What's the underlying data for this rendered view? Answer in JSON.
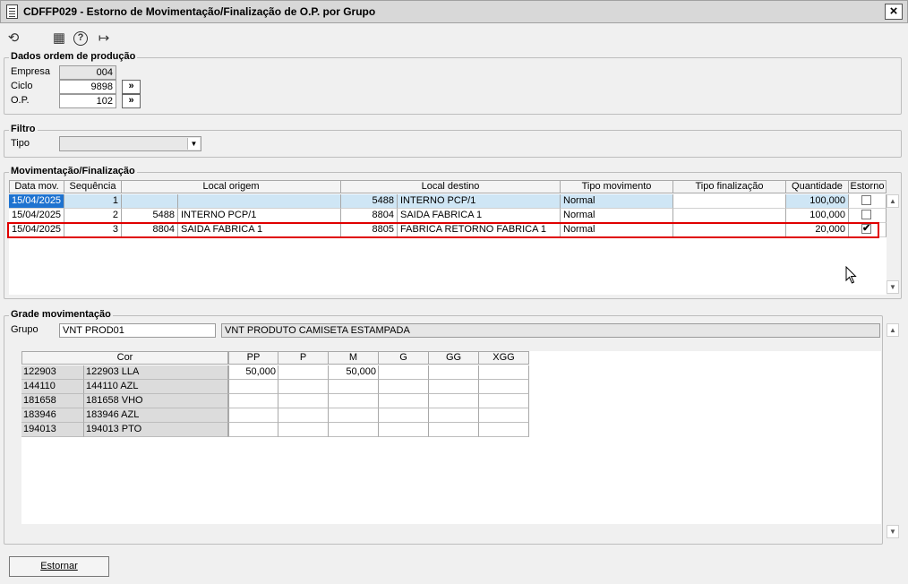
{
  "window": {
    "title": "CDFFP029 - Estorno de Movimentação/Finalização de O.P. por Grupo",
    "close_label": "×"
  },
  "toolbar": {
    "icons": [
      "undo-icon",
      "calendar-icon",
      "help-icon",
      "exit-icon"
    ],
    "undo_glyph": "⟲",
    "calendar_glyph": "▦",
    "help_glyph": "?",
    "exit_glyph": "↦"
  },
  "dados": {
    "legend": "Dados ordem de produção",
    "empresa_label": "Empresa",
    "empresa_value": "004",
    "ciclo_label": "Ciclo",
    "ciclo_value": "9898",
    "op_label": "O.P.",
    "op_value": "102",
    "lookup_label": "»"
  },
  "filtro": {
    "legend": "Filtro",
    "tipo_label": "Tipo",
    "tipo_value": ""
  },
  "movimentacao": {
    "legend": "Movimentação/Finalização",
    "headers": {
      "data": "Data mov.",
      "seq": "Sequência",
      "origem": "Local origem",
      "destino": "Local destino",
      "tipo_mov": "Tipo movimento",
      "tipo_fin": "Tipo finalização",
      "qtd": "Quantidade",
      "estorno": "Estorno"
    },
    "rows": [
      {
        "data": "15/04/2025",
        "seq": "1",
        "origem_cod": "",
        "origem_desc": "",
        "destino_cod": "5488",
        "destino_desc": "INTERNO PCP/1",
        "tipo_mov": "Normal",
        "tipo_fin": "",
        "qtd": "100,000",
        "estorno": ""
      },
      {
        "data": "15/04/2025",
        "seq": "2",
        "origem_cod": "5488",
        "origem_desc": "INTERNO PCP/1",
        "destino_cod": "8804",
        "destino_desc": "SAIDA FABRICA 1",
        "tipo_mov": "Normal",
        "tipo_fin": "",
        "qtd": "100,000",
        "estorno": ""
      },
      {
        "data": "15/04/2025",
        "seq": "3",
        "origem_cod": "8804",
        "origem_desc": "SAIDA FABRICA 1",
        "destino_cod": "8805",
        "destino_desc": "FABRICA RETORNO FABRICA 1",
        "tipo_mov": "Normal",
        "tipo_fin": "",
        "qtd": "20,000",
        "estorno": "✔"
      }
    ]
  },
  "grade": {
    "legend": "Grade movimentação",
    "grupo_label": "Grupo",
    "grupo_value": "VNT PROD01",
    "grupo_desc": "VNT PRODUTO CAMISETA ESTAMPADA",
    "headers": {
      "cor": "Cor",
      "pp": "PP",
      "p": "P",
      "m": "M",
      "g": "G",
      "gg": "GG",
      "xgg": "XGG"
    },
    "rows": [
      {
        "cod": "122903",
        "desc": "122903 LLA",
        "pp": "50,000",
        "p": "",
        "m": "50,000",
        "g": "",
        "gg": "",
        "xgg": ""
      },
      {
        "cod": "144110",
        "desc": "144110 AZL",
        "pp": "",
        "p": "",
        "m": "",
        "g": "",
        "gg": "",
        "xgg": ""
      },
      {
        "cod": "181658",
        "desc": "181658 VHO",
        "pp": "",
        "p": "",
        "m": "",
        "g": "",
        "gg": "",
        "xgg": ""
      },
      {
        "cod": "183946",
        "desc": "183946 AZL",
        "pp": "",
        "p": "",
        "m": "",
        "g": "",
        "gg": "",
        "xgg": ""
      },
      {
        "cod": "194013",
        "desc": "194013 PTO",
        "pp": "",
        "p": "",
        "m": "",
        "g": "",
        "gg": "",
        "xgg": ""
      }
    ]
  },
  "footer": {
    "estornar_label": "Estornar"
  },
  "colors": {
    "selected_row": "#cfe6f5",
    "selected_date": "#1e73d0",
    "highlight_border": "#e00000"
  }
}
